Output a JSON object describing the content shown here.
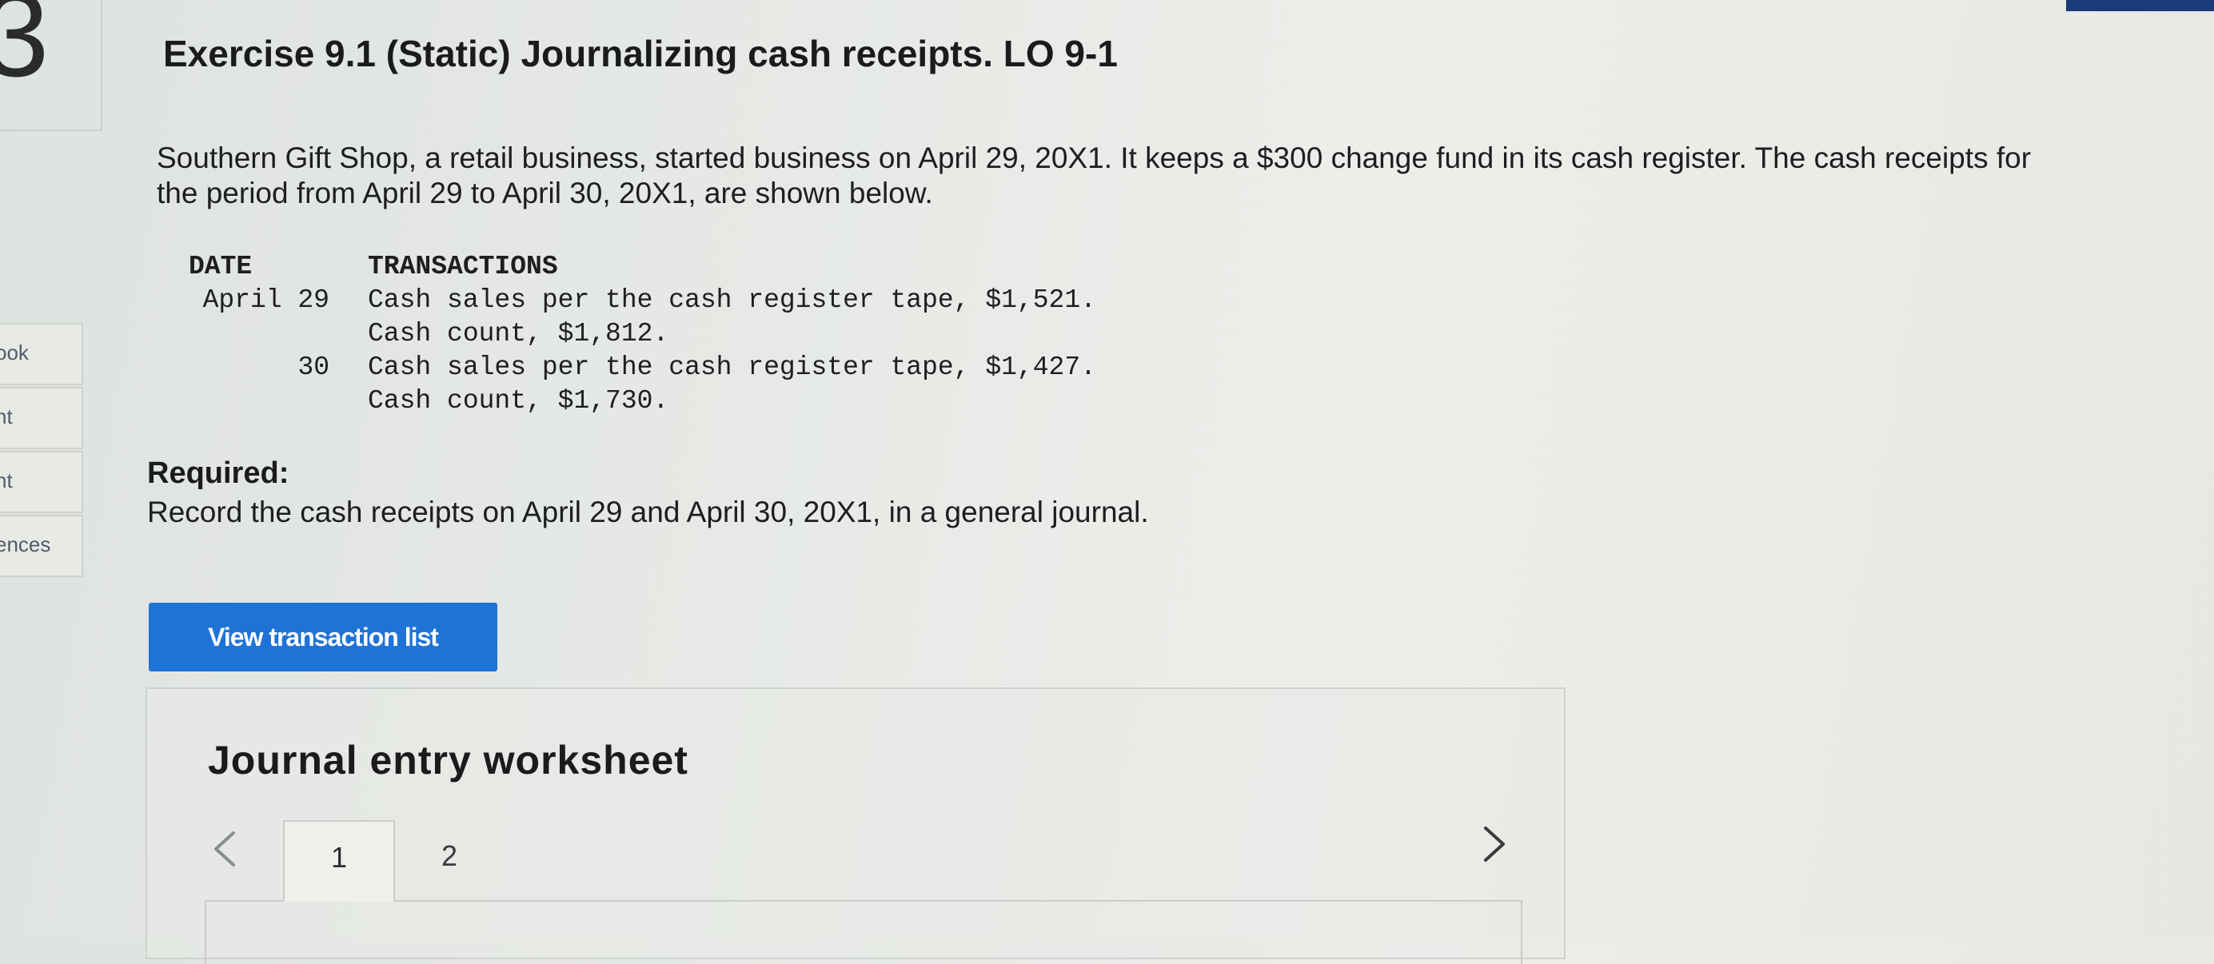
{
  "sidebar": {
    "question_number": "3",
    "items": [
      {
        "label": "ook"
      },
      {
        "label": "nt"
      },
      {
        "label": "nt"
      },
      {
        "label": "ences"
      }
    ]
  },
  "exercise": {
    "title": "Exercise 9.1 (Static) Journalizing cash receipts. LO 9-1",
    "intro": "Southern Gift Shop, a retail business, started business on April 29, 20X1. It keeps a $300 change fund in its cash register. The cash receipts for the period from April 29 to April 30, 20X1, are shown below.",
    "table": {
      "headers": {
        "date": "DATE",
        "transactions": "TRANSACTIONS"
      },
      "rows": [
        {
          "date": "April 29",
          "text": "Cash sales per the cash register tape, $1,521."
        },
        {
          "date": "",
          "text": "Cash count, $1,812."
        },
        {
          "date": "30",
          "text": "Cash sales per the cash register tape, $1,427."
        },
        {
          "date": "",
          "text": "Cash count, $1,730."
        }
      ]
    },
    "required_label": "Required:",
    "required_text": "Record the cash receipts on April 29 and April 30, 20X1, in a general journal."
  },
  "buttons": {
    "view_transactions": "View transaction list"
  },
  "worksheet": {
    "title": "Journal entry worksheet",
    "tabs": [
      "1",
      "2"
    ],
    "active_tab": "1"
  },
  "colors": {
    "accent": "#1f73d6",
    "corner": "#1a3a78"
  },
  "icons": {
    "prev": "chevron-left-icon",
    "next": "chevron-right-icon"
  }
}
